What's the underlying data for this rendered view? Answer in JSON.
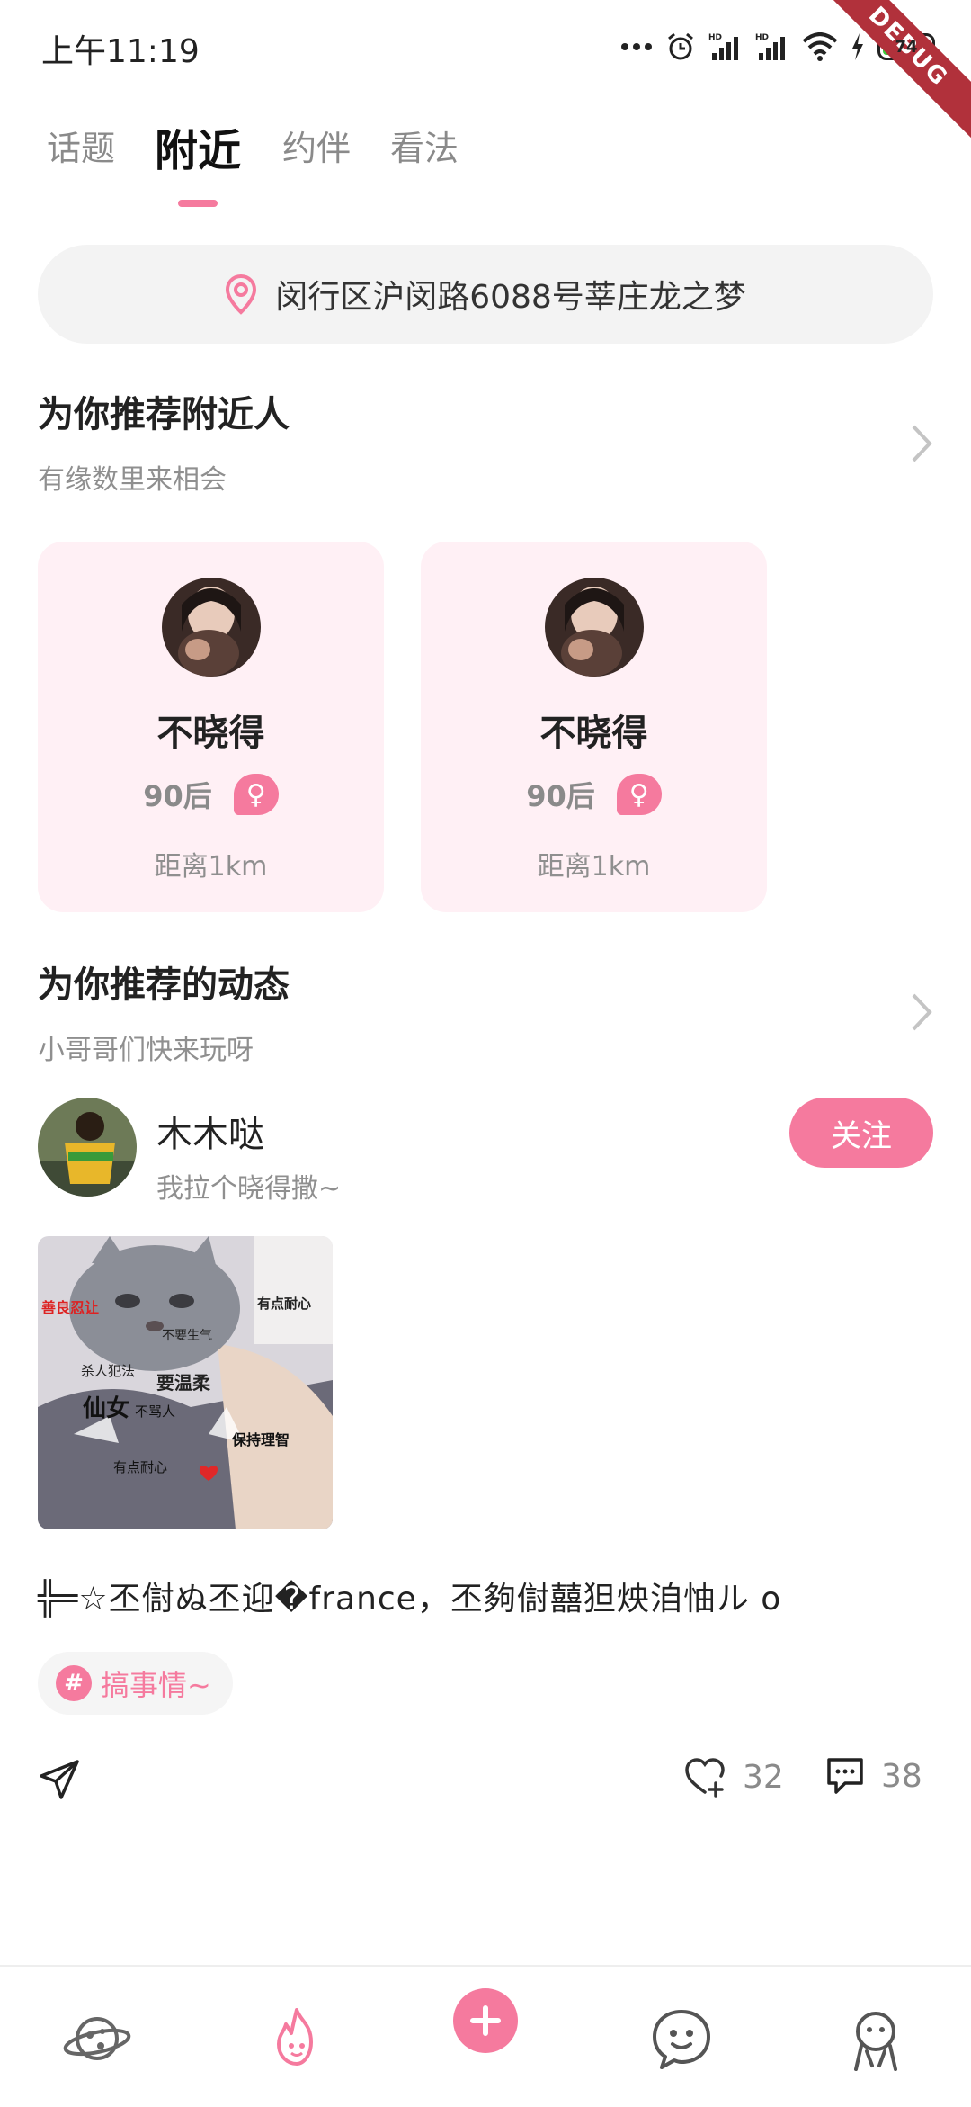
{
  "status_bar": {
    "time": "上午11:19",
    "battery": "74",
    "debug_label": "DEBUG"
  },
  "tabs": [
    {
      "label": "话题",
      "active": false
    },
    {
      "label": "附近",
      "active": true
    },
    {
      "label": "约伴",
      "active": false
    },
    {
      "label": "看法",
      "active": false
    }
  ],
  "location": {
    "address": "闵行区沪闵路6088号莘庄龙之梦"
  },
  "nearby_section": {
    "title": "为你推荐附近人",
    "subtitle": "有缘数里来相会",
    "people": [
      {
        "name": "不晓得",
        "age": "90后",
        "gender": "♀",
        "distance": "距离1km"
      },
      {
        "name": "不晓得",
        "age": "90后",
        "gender": "♀",
        "distance": "距离1km"
      }
    ]
  },
  "feed_section": {
    "title": "为你推荐的动态",
    "subtitle": "小哥哥们快来玩呀",
    "post": {
      "author": "木木哒",
      "bio": "我拉个晓得撒~",
      "follow_label": "关注",
      "text": "╬═☆丕傠ぬ丕迎�france，丕夠傠囍狚炴洎怞ル o",
      "image_captions": [
        "善良忍让",
        "有点耐心",
        "不要生气",
        "杀人犯法",
        "要温柔",
        "仙女",
        "不骂人",
        "保持理智",
        "有点耐心"
      ],
      "tag": "搞事情~",
      "likes": "32",
      "comments": "38"
    }
  },
  "colors": {
    "accent": "#f57a9e",
    "card_bg": "#fff0f5",
    "muted_text": "#8f8f8f"
  },
  "icons": {
    "location": "location-pin-icon",
    "share": "paper-plane-icon",
    "like": "heart-plus-icon",
    "comment": "comment-bubble-icon",
    "nav": [
      "planet-icon",
      "flame-icon",
      "plus-icon",
      "smile-chat-icon",
      "profile-icon"
    ]
  }
}
